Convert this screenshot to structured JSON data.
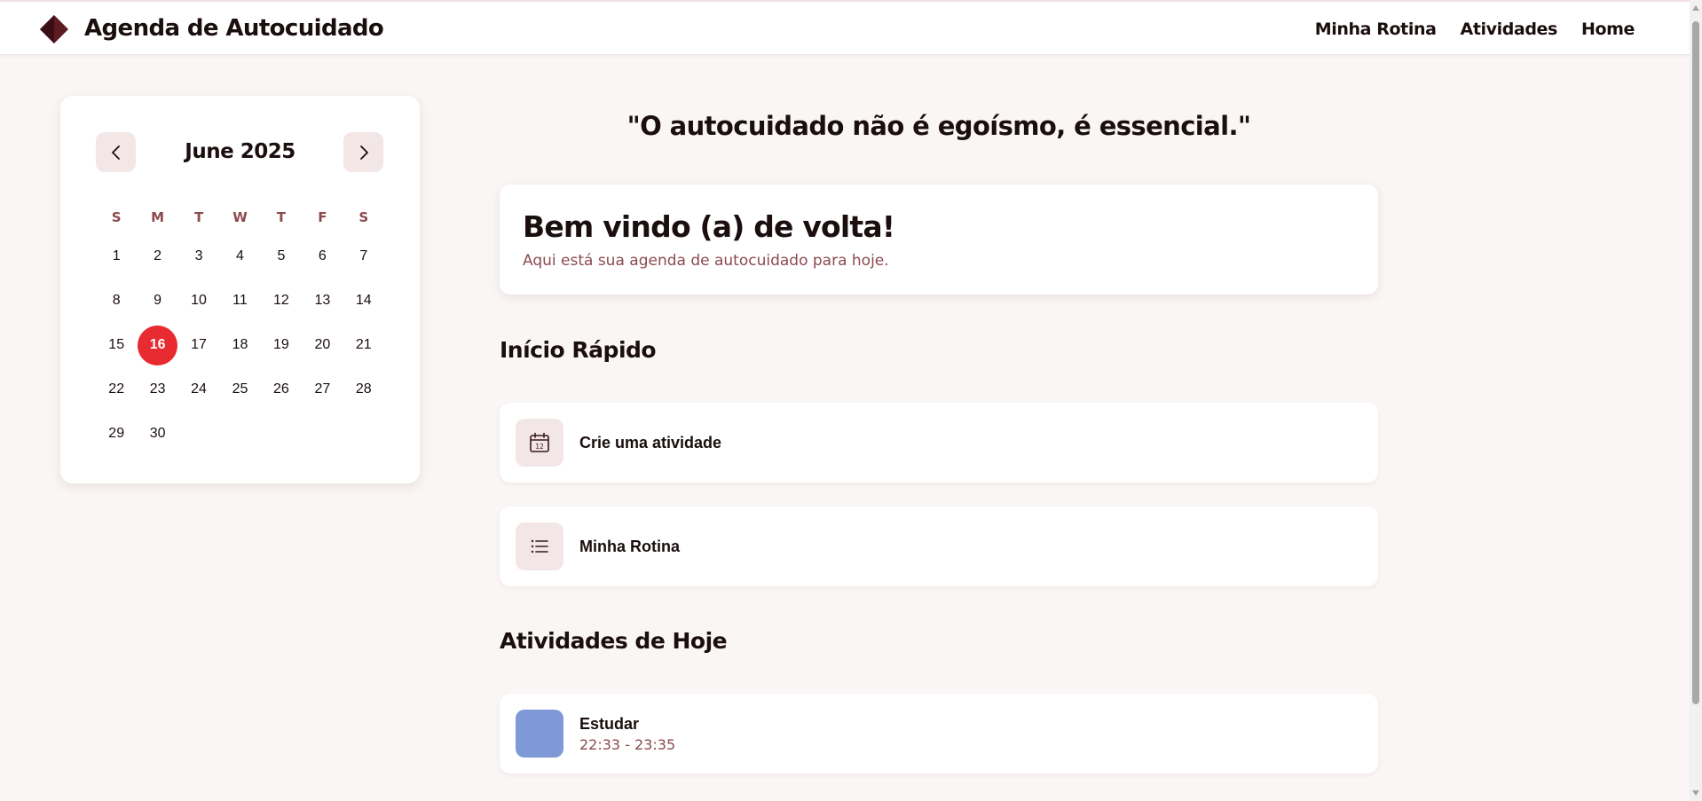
{
  "header": {
    "app_title": "Agenda de Autocuidado",
    "logo_icon": "diamond-logo-icon",
    "nav": [
      "Minha Rotina",
      "Atividades",
      "Home"
    ]
  },
  "calendar": {
    "month_label": "June 2025",
    "prev_icon": "chevron-left-icon",
    "next_icon": "chevron-right-icon",
    "weekdays": [
      "S",
      "M",
      "T",
      "W",
      "T",
      "F",
      "S"
    ],
    "first_weekday_index": 0,
    "days": [
      "1",
      "2",
      "3",
      "4",
      "5",
      "6",
      "7",
      "8",
      "9",
      "10",
      "11",
      "12",
      "13",
      "14",
      "15",
      "16",
      "17",
      "18",
      "19",
      "20",
      "21",
      "22",
      "23",
      "24",
      "25",
      "26",
      "27",
      "28",
      "29",
      "30"
    ],
    "today": "16",
    "today_color": "#e82a31"
  },
  "main": {
    "quote": "\"O autocuidado não é egoísmo, é essencial.\"",
    "welcome_title": "Bem vindo (a) de volta!",
    "welcome_subtitle": "Aqui está sua agenda de autocuidado para hoje.",
    "quick_start_title": "Início Rápido",
    "quick_actions": [
      {
        "label": "Crie uma atividade",
        "icon": "calendar-icon"
      },
      {
        "label": "Minha Rotina",
        "icon": "list-icon"
      }
    ],
    "today_title": "Atividades de Hoje",
    "activities": [
      {
        "name": "Estudar",
        "time": "22:33 - 23:35",
        "color": "#7f98d6"
      }
    ]
  },
  "colors": {
    "accent": "#8b4a4f",
    "accent_soft": "#f2e6e6",
    "background": "#faf6f5",
    "text": "#1b0e0e"
  }
}
